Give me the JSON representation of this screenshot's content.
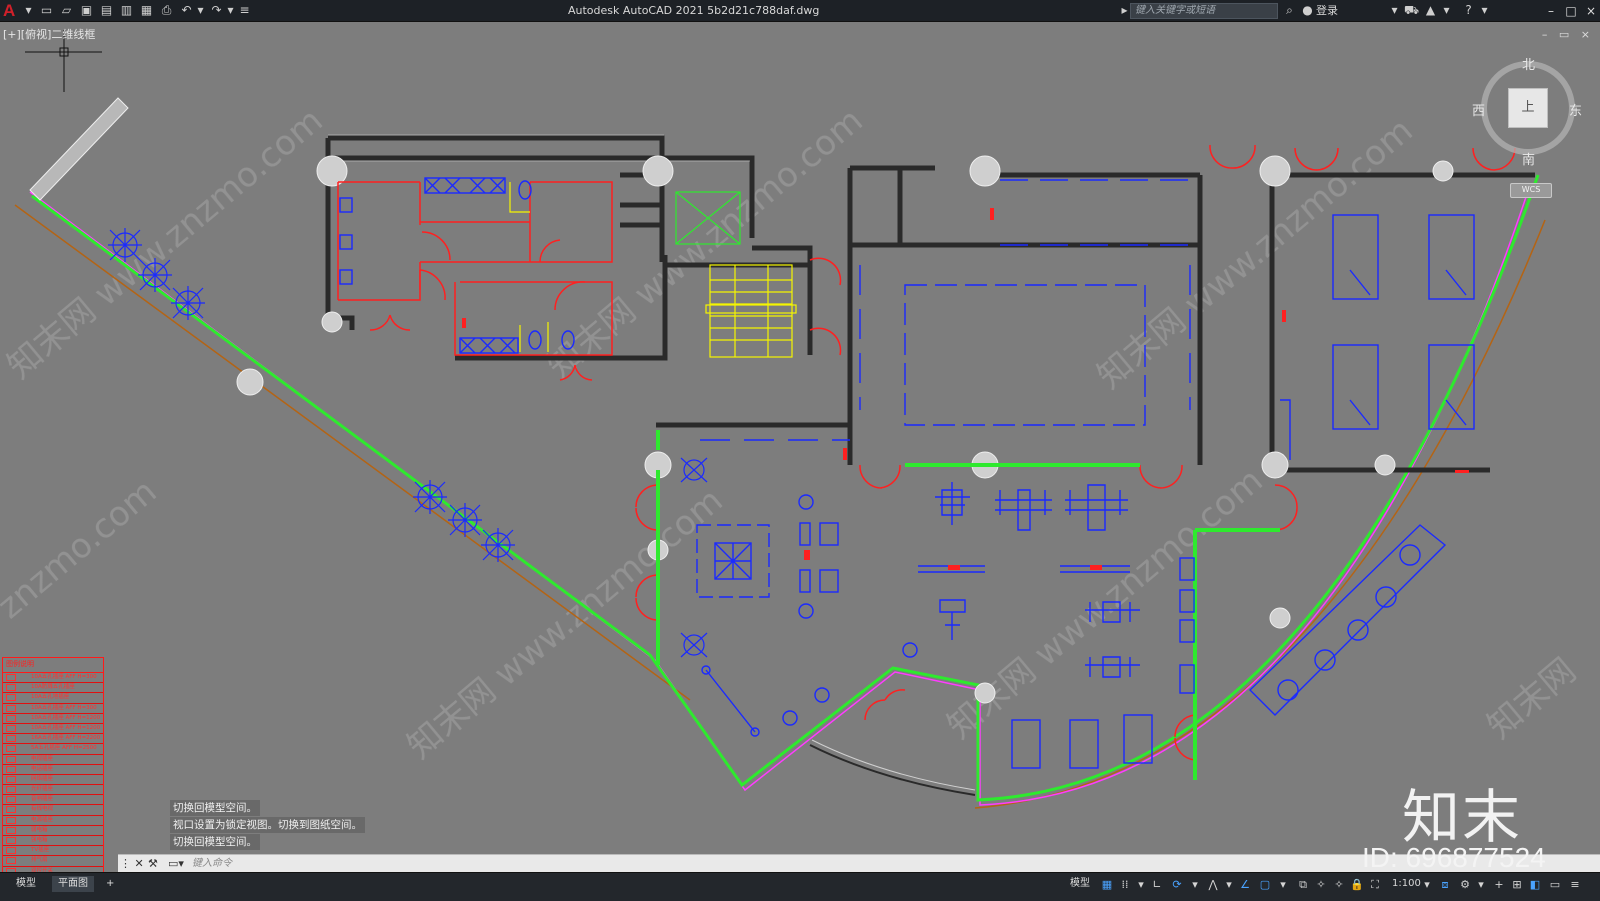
{
  "titlebar": {
    "title": "Autodesk AutoCAD 2021    5b2d21c788daf.dwg",
    "logo": "A",
    "search_placeholder": "键入关键字或短语",
    "signin_label": "登录",
    "quick_access_icons": [
      "new-icon",
      "open-icon",
      "save-icon",
      "save-as-icon",
      "publish-icon",
      "plot-preview-icon",
      "plot-icon",
      "undo-icon",
      "redo-icon",
      "customize-icon"
    ]
  },
  "viewport": {
    "label": "[+][俯视]二维线框",
    "controls": "–  ▭  ×"
  },
  "viewcube": {
    "north": "北",
    "south": "南",
    "east": "东",
    "west": "西",
    "face": "上",
    "wcs": "WCS"
  },
  "legend": {
    "title": "图例说明",
    "rows": [
      "10A五孔插座 AFF H=300",
      "10A防溅五孔插座",
      "10A五孔地插座",
      "10A五孔插座 AFF H=300",
      "10A五孔插座 AFF H=1200",
      "10A五孔插座 AFF H=1200",
      "16A五孔插座 AFF H=2200",
      "5A五孔插座 AFF H=2500",
      "电视插座",
      "电话插座",
      "网络插座",
      "光纤插座",
      "音响插座",
      "有线电视",
      "电源插座",
      "弱电箱",
      "强电箱",
      "TV插座",
      "排气扇",
      "双控开关",
      "单联开关",
      "双联开关",
      "三联开关"
    ]
  },
  "command": {
    "history": [
      "切换回模型空间。",
      "视口设置为锁定视图。切换到图纸空间。",
      "切换回模型空间。"
    ],
    "input_placeholder": "键入命令"
  },
  "statusbar": {
    "tabs": [
      "模型",
      "平面图"
    ],
    "add_tab": "+",
    "model_label": "模型",
    "scale": "1:100"
  },
  "watermark": {
    "brand": "知末",
    "id": "ID: 696877524",
    "site": "知末网 www.znzmo.com"
  },
  "colors": {
    "canvas": "#7d7d7d",
    "wall": "#2a2a2a",
    "door": "#ff2020",
    "furniture": "#1a2aff",
    "stair": "#f5f500",
    "outline_green": "#2eea2e",
    "outline_magenta": "#ff3cff",
    "outline_brown": "#b46414"
  }
}
